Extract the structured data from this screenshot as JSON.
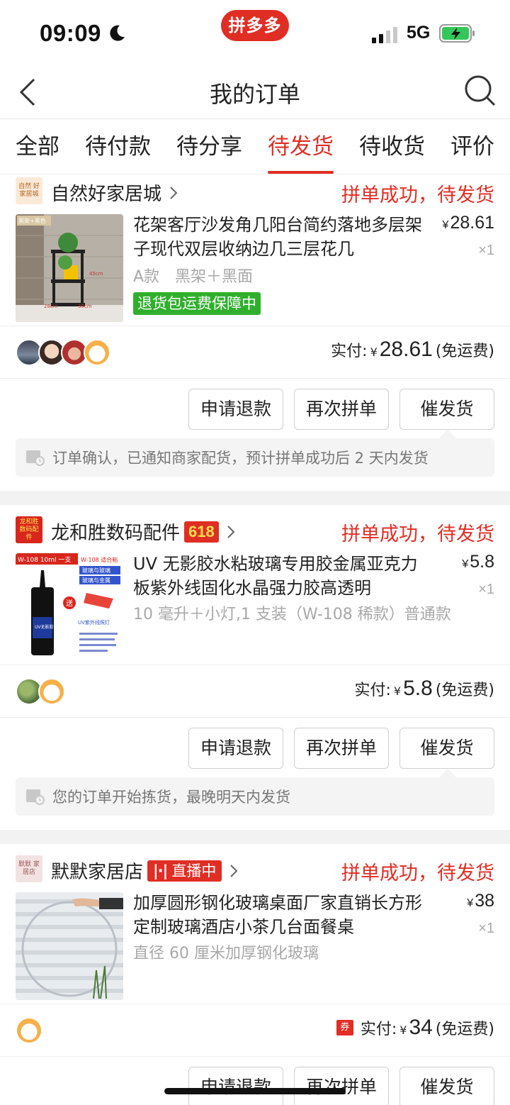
{
  "status_bar": {
    "time": "09:09",
    "network": "5G",
    "app_logo": "拼多多",
    "moon_icon": "moon-icon",
    "battery_state": "charging"
  },
  "nav": {
    "title": "我的订单",
    "back_icon": "back-chevron-icon",
    "search_icon": "search-icon"
  },
  "tabs": [
    {
      "label": "全部",
      "active": false
    },
    {
      "label": "待付款",
      "active": false
    },
    {
      "label": "待分享",
      "active": false
    },
    {
      "label": "待发货",
      "active": true
    },
    {
      "label": "待收货",
      "active": false
    },
    {
      "label": "评价",
      "active": false
    }
  ],
  "buttons": {
    "refund": "申请退款",
    "regroup": "再次拼单",
    "urge": "催发货"
  },
  "orders": [
    {
      "shop": {
        "name": "自然好家居城",
        "logo_text": "自然 好家居城",
        "badge": ""
      },
      "status": "拼单成功，待发货",
      "product": {
        "title": "花架客厅沙发角几阳台简约落地多层架子现代双层收纳边几三层花几",
        "spec": "A款　黑架＋黑面",
        "price_symbol": "¥",
        "price": "28.61",
        "qty": "×1",
        "tag": "退货包运费保障中",
        "thumb_label_1": "黑架+黑色",
        "thumb_dim_1": "45cm",
        "thumb_dim_2": "28cm",
        "thumb_dim_3": "35cm"
      },
      "payment": {
        "label": "实付:",
        "symbol": "¥",
        "amount": "28.61",
        "shipping": "(免运费)"
      },
      "notice": "订单确认，已通知商家配货，预计拼单成功后 2 天内发货"
    },
    {
      "shop": {
        "name": "龙和胜数码配件",
        "logo_text": "龙和胜 数码配件",
        "badge": "618"
      },
      "status": "拼单成功，待发货",
      "product": {
        "title": "UV 无影胶水粘玻璃专用胶金属亚克力板紫外线固化水晶强力胶高透明",
        "spec": "10 毫升＋小灯,1 支装（W-108 稀款）普通款",
        "price_symbol": "¥",
        "price": "5.8",
        "qty": "×1",
        "thumb_label_1": "W-108 10ml 一支",
        "thumb_label_2": "W-108 适合粘",
        "thumb_label_3": "玻璃与玻璃",
        "thumb_label_4": "玻璃与金属",
        "thumb_label_5": "送",
        "thumb_label_6": "UV紫外线照灯",
        "thumb_label_7": "UV无影胶"
      },
      "payment": {
        "label": "实付:",
        "symbol": "¥",
        "amount": "5.8",
        "shipping": "(免运费)"
      },
      "notice": "您的订单开始拣货，最晚明天内发货"
    },
    {
      "shop": {
        "name": "默默家居店",
        "logo_text": "默默 家居店",
        "badge": "直播中"
      },
      "status": "拼单成功，待发货",
      "product": {
        "title": "加厚圆形钢化玻璃桌面厂家直销长方形定制玻璃酒店小茶几台面餐桌",
        "spec": "直径 60 厘米加厚钢化玻璃",
        "price_symbol": "¥",
        "price": "38",
        "qty": "×1"
      },
      "payment": {
        "coupon": "券",
        "label": "实付:",
        "symbol": "¥",
        "amount": "34",
        "shipping": "(免运费)"
      }
    }
  ],
  "colors": {
    "brand_red": "#e02e24",
    "tag_green": "#2fb02c",
    "muted": "#a8a8a8",
    "divider": "#f2f2f2"
  }
}
